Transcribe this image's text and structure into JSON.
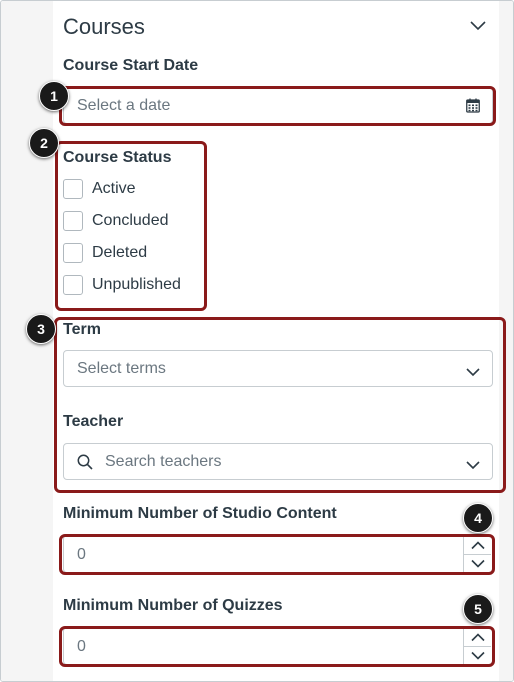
{
  "panel": {
    "title": "Courses",
    "collapse_icon": "chevron-down-icon"
  },
  "course_start_date": {
    "label": "Course Start Date",
    "placeholder": "Select a date",
    "icon": "calendar-icon"
  },
  "course_status": {
    "label": "Course Status",
    "options": [
      {
        "label": "Active",
        "checked": false
      },
      {
        "label": "Concluded",
        "checked": false
      },
      {
        "label": "Deleted",
        "checked": false
      },
      {
        "label": "Unpublished",
        "checked": false
      }
    ]
  },
  "term": {
    "label": "Term",
    "placeholder": "Select terms",
    "icon": "chevron-down-icon"
  },
  "teacher": {
    "label": "Teacher",
    "placeholder": "Search teachers",
    "icons": [
      "search-icon",
      "chevron-down-icon"
    ]
  },
  "min_studio_content": {
    "label": "Minimum Number of Studio Content",
    "value": "0"
  },
  "min_quizzes": {
    "label": "Minimum Number of Quizzes",
    "value": "0"
  },
  "callouts": [
    "1",
    "2",
    "3",
    "4",
    "5"
  ],
  "colors": {
    "callout": "#8a1a1a",
    "badge": "#1a1a1a",
    "text": "#2d3b45",
    "placeholder": "#6b7780",
    "border": "#c7cdd1"
  }
}
